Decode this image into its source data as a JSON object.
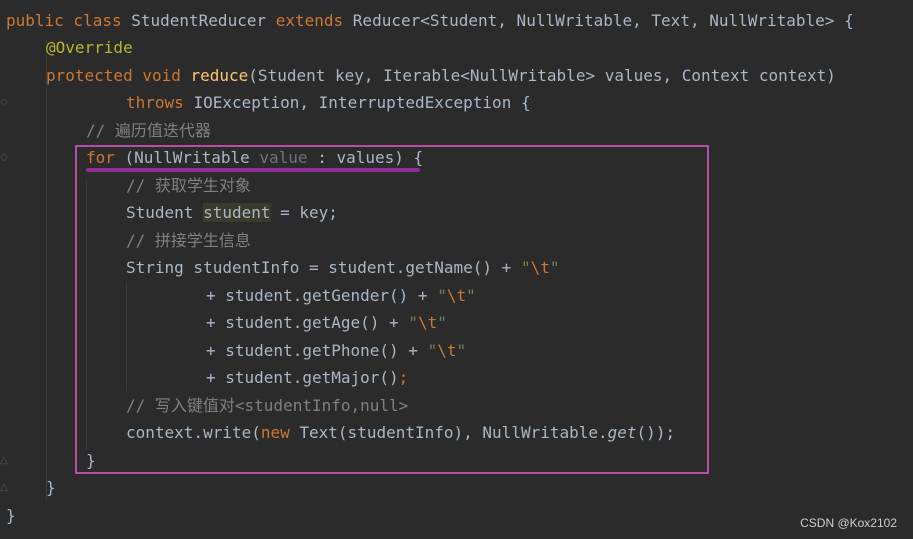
{
  "code": {
    "l1": {
      "a": "public class ",
      "b": "StudentReducer ",
      "c": "extends ",
      "d": "Reducer<Student, NullWritable, Text, NullWritable> {"
    },
    "l2": {
      "a": "@Override"
    },
    "l3": {
      "a": "protected void ",
      "b": "reduce",
      "c": "(Student key, Iterable<NullWritable> values, Context context)"
    },
    "l4": {
      "a": "throws ",
      "b": "IOException, InterruptedException {"
    },
    "l5": {
      "a": "// 遍历值迭代器"
    },
    "l6": {
      "a": "for ",
      "b": "(NullWritable ",
      "c": "value",
      "d": " : values) {"
    },
    "l7": {
      "a": "// 获取学生对象"
    },
    "l8": {
      "a": "Student ",
      "b": "student",
      "c": " = key;"
    },
    "l9": {
      "a": "// 拼接学生信息"
    },
    "l10": {
      "a": "String studentInfo = student.getName() + ",
      "b": "\"",
      "c": "\\t",
      "d": "\""
    },
    "l11": {
      "a": "+ student.getGender() + ",
      "b": "\"",
      "c": "\\t",
      "d": "\""
    },
    "l12": {
      "a": "+ student.getAge() + ",
      "b": "\"",
      "c": "\\t",
      "d": "\""
    },
    "l13": {
      "a": "+ student.getPhone() + ",
      "b": "\"",
      "c": "\\t",
      "d": "\""
    },
    "l14": {
      "a": "+ student.getMajor()",
      "b": ";"
    },
    "l15": {
      "a": "// 写入键值对<studentInfo,null>"
    },
    "l16": {
      "a": "context.write(",
      "b": "new ",
      "c": "Text(studentInfo), NullWritable.",
      "d": "get",
      "e": "());"
    },
    "l17": {
      "a": "}"
    },
    "l18": {
      "a": "}"
    },
    "l19": {
      "a": "}"
    }
  },
  "watermark": "CSDN @Kox2102",
  "colors": {
    "background": "#2b2b2b",
    "keyword": "#cc7832",
    "annotation": "#bbb529",
    "method": "#ffc66d",
    "comment": "#808080",
    "string": "#6a8759",
    "highlight_box": "#b44fa6"
  }
}
